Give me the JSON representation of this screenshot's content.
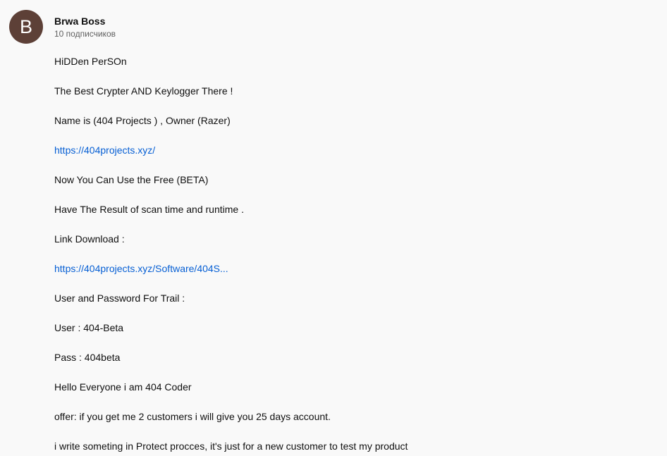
{
  "channel": {
    "avatar_letter": "B",
    "avatar_color": "#5d4037",
    "name": "Brwa Boss",
    "subscribers": "10 подписчиков"
  },
  "description": {
    "line_1": "HiDDen PerSOn",
    "line_2": "The Best Crypter AND Keylogger There !",
    "line_3": "Name is (404 Projects ) , Owner (Razer)",
    "link_1": "https://404projects.xyz/",
    "line_4": "Now You Can Use the Free (BETA)",
    "line_5": "Have The Result of scan time and runtime .",
    "line_6": "Link Download :",
    "link_2": "https://404projects.xyz/Software/404S...",
    "line_7": "User and Password For Trail :",
    "line_8": "User : 404-Beta",
    "line_9": "Pass : 404beta",
    "line_10": "Hello Everyone i am 404 Coder",
    "line_11": "offer: if you get me 2 customers i will give you 25 days account.",
    "line_12": "i write someting in Protect procces, it's just for a new customer to test my product"
  },
  "colors": {
    "link": "#065fd4",
    "text": "#0f0f0f",
    "secondary_text": "#606060",
    "background": "#f9f9f9"
  }
}
